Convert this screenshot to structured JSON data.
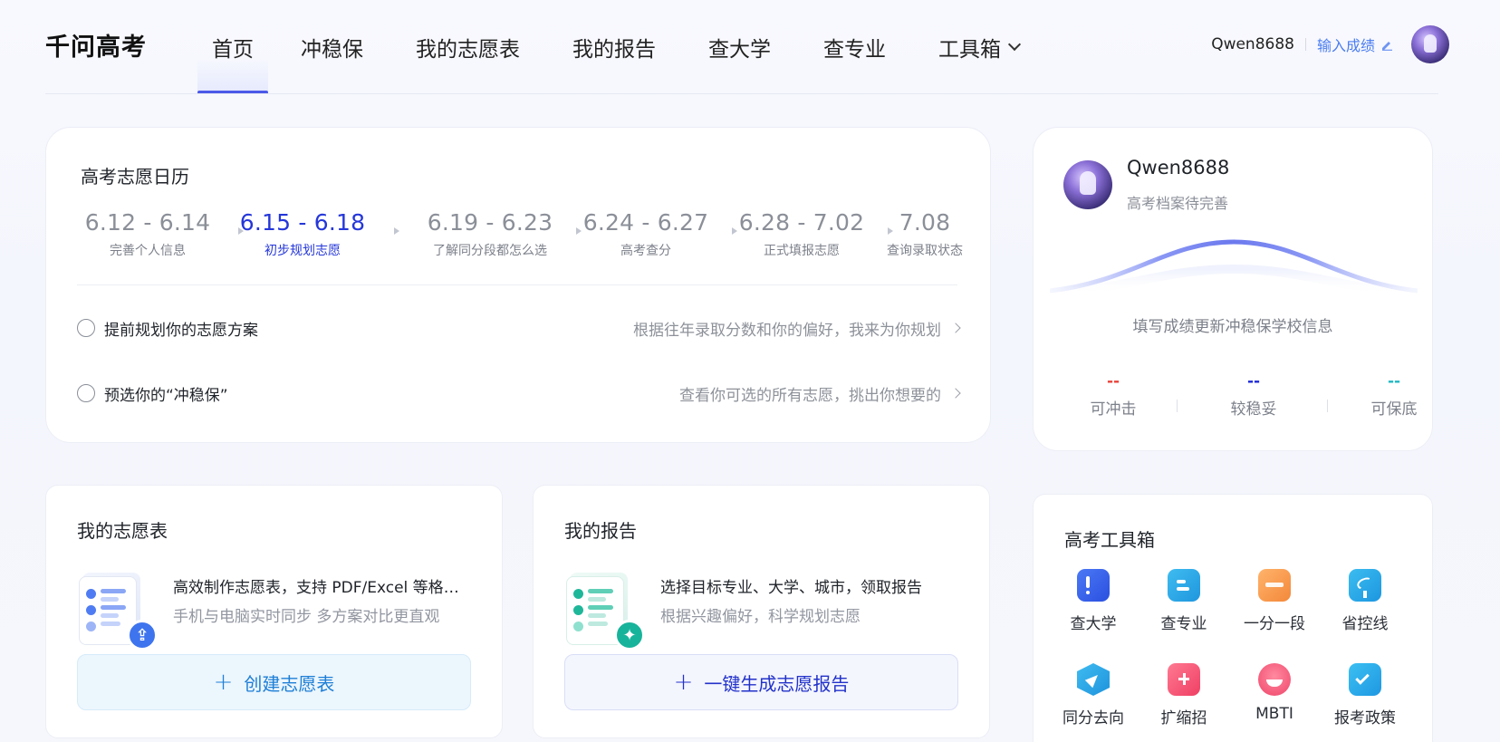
{
  "app": {
    "logo": "千问高考"
  },
  "nav": {
    "items": [
      "首页",
      "冲稳保",
      "我的志愿表",
      "我的报告",
      "查大学",
      "查专业",
      "工具箱"
    ],
    "active_index": 0
  },
  "user": {
    "name": "Qwen8688",
    "score_link": "输入成绩"
  },
  "calendar": {
    "title": "高考志愿日历",
    "stages": [
      {
        "date": "6.12 - 6.14",
        "label": "完善个人信息"
      },
      {
        "date": "6.15 - 6.18",
        "label": "初步规划志愿"
      },
      {
        "date": "6.19 - 6.23",
        "label": "了解同分段都怎么选"
      },
      {
        "date": "6.24 - 6.27",
        "label": "高考查分"
      },
      {
        "date": "6.28 - 7.02",
        "label": "正式填报志愿"
      },
      {
        "date": "7.08",
        "label": "查询录取状态"
      }
    ],
    "active_stage": 1,
    "tasks": [
      {
        "title": "提前规划你的志愿方案",
        "desc": "根据往年录取分数和你的偏好，我来为你规划"
      },
      {
        "title": "预选你的“冲稳保”",
        "desc": "查看你可选的所有志愿，挑出你想要的"
      }
    ]
  },
  "profile": {
    "name": "Qwen8688",
    "status": "高考档案待完善",
    "hint": "填写成绩更新冲稳保学校信息",
    "stats": [
      {
        "value": "--",
        "label": "可冲击",
        "color": "#e8453c"
      },
      {
        "value": "--",
        "label": "较稳妥",
        "color": "#1f2ad6"
      },
      {
        "value": "--",
        "label": "可保底",
        "color": "#22b8c4"
      }
    ]
  },
  "my_form": {
    "title": "我的志愿表",
    "desc_main": "高效制作志愿表，支持 PDF/Excel 等格式导出",
    "desc_sub": "手机与电脑实时同步 多方案对比更直观",
    "cta": "创建志愿表"
  },
  "my_report": {
    "title": "我的报告",
    "desc_main": "选择目标专业、大学、城市，领取报告",
    "desc_sub": "根据兴趣偏好，科学规划志愿",
    "cta": "一键生成志愿报告"
  },
  "tools": {
    "title": "高考工具箱",
    "items": [
      {
        "label": "查大学",
        "icon": "university-icon",
        "color": "#2f5cf0"
      },
      {
        "label": "查专业",
        "icon": "major-book-icon",
        "color": "#2aa7e8"
      },
      {
        "label": "一分一段",
        "icon": "score-rank-icon",
        "color": "#f39a4c"
      },
      {
        "label": "省控线",
        "icon": "control-line-icon",
        "color": "#25a6e6"
      },
      {
        "label": "同分去向",
        "icon": "same-score-icon",
        "color": "#2a9fe8"
      },
      {
        "label": "扩缩招",
        "icon": "enrollment-change-icon",
        "color": "#f0456a"
      },
      {
        "label": "MBTI",
        "icon": "mbti-icon",
        "color": "#f2506e"
      },
      {
        "label": "报考政策",
        "icon": "policy-check-icon",
        "color": "#22a3e6"
      }
    ]
  },
  "colors": {
    "accent": "#4b5ae8",
    "active_text": "#2537d9",
    "link": "#4a7cf0"
  }
}
